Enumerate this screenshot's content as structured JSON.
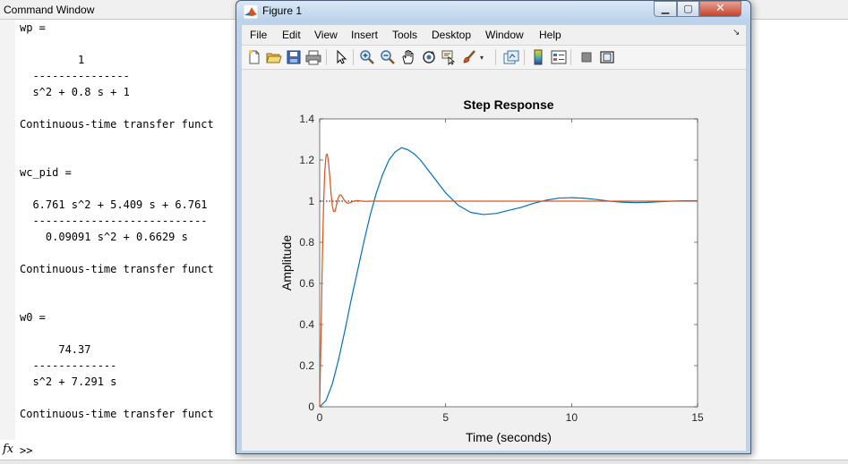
{
  "command_window": {
    "title": "Command Window",
    "lines": [
      "wp =",
      "",
      "         1",
      "  ---------------",
      "  s^2 + 0.8 s + 1",
      "",
      "Continuous-time transfer funct",
      "",
      "",
      "wc_pid =",
      "",
      "  6.761 s^2 + 5.409 s + 6.761",
      "  ---------------------------",
      "    0.09091 s^2 + 0.6629 s",
      "",
      "Continuous-time transfer funct",
      "",
      "",
      "w0 =",
      "",
      "      74.37",
      "  -------------",
      "  s^2 + 7.291 s",
      "",
      "Continuous-time transfer funct"
    ],
    "fx_icon": "fx",
    "prompt": ">>"
  },
  "figure_window": {
    "title": "Figure 1",
    "window_buttons": {
      "minimize": "minimize-icon",
      "maximize": "maximize-icon",
      "close": "close-icon"
    },
    "menu": [
      "File",
      "Edit",
      "View",
      "Insert",
      "Tools",
      "Desktop",
      "Window",
      "Help"
    ],
    "toolbar_icons": [
      "new-figure-icon",
      "open-file-icon",
      "save-icon",
      "print-icon",
      "select-arrow-icon",
      "zoom-in-icon",
      "zoom-out-icon",
      "pan-icon",
      "rotate-3d-icon",
      "data-cursor-icon",
      "brush-icon",
      "link-plot-icon",
      "colorbar-icon",
      "legend-icon",
      "hide-plot-tools-icon",
      "show-plot-tools-icon"
    ]
  },
  "chart_data": {
    "type": "line",
    "title": "Step Response",
    "xlabel": "Time (seconds)",
    "ylabel": "Amplitude",
    "xlim": [
      0,
      15
    ],
    "ylim": [
      0,
      1.4
    ],
    "xticks": [
      0,
      5,
      10,
      15
    ],
    "yticks": [
      0,
      0.2,
      0.4,
      0.6,
      0.8,
      1,
      1.2,
      1.4
    ],
    "grid": false,
    "colors": {
      "series_blue": "#0072bd",
      "series_orange": "#d95319"
    },
    "series": [
      {
        "color": "#0072bd",
        "x": [
          0,
          0.25,
          0.5,
          0.75,
          1,
          1.25,
          1.5,
          1.75,
          2,
          2.25,
          2.5,
          2.75,
          3,
          3.25,
          3.5,
          3.75,
          4,
          4.5,
          5,
          5.5,
          6,
          6.5,
          7,
          7.5,
          8,
          8.5,
          9,
          9.5,
          10,
          10.5,
          11,
          11.5,
          12,
          12.5,
          13,
          13.5,
          14,
          14.5,
          15
        ],
        "y": [
          0,
          0.03,
          0.11,
          0.23,
          0.37,
          0.52,
          0.66,
          0.8,
          0.93,
          1.04,
          1.13,
          1.2,
          1.24,
          1.26,
          1.25,
          1.23,
          1.2,
          1.12,
          1.04,
          0.98,
          0.945,
          0.935,
          0.94,
          0.955,
          0.97,
          0.99,
          1.005,
          1.015,
          1.017,
          1.014,
          1.008,
          1.0,
          0.995,
          0.993,
          0.994,
          0.997,
          1.0,
          1.002,
          1.002
        ]
      },
      {
        "color": "#d95319",
        "x": [
          0,
          0.05,
          0.1,
          0.15,
          0.2,
          0.25,
          0.3,
          0.35,
          0.4,
          0.45,
          0.5,
          0.55,
          0.6,
          0.65,
          0.7,
          0.75,
          0.8,
          0.85,
          0.9,
          0.95,
          1.0,
          1.1,
          1.2,
          1.3,
          1.4,
          1.5,
          1.6,
          1.8,
          2.0,
          15
        ],
        "y": [
          0,
          0.33,
          0.68,
          0.96,
          1.14,
          1.22,
          1.23,
          1.19,
          1.12,
          1.04,
          0.98,
          0.95,
          0.95,
          0.97,
          1.0,
          1.02,
          1.03,
          1.03,
          1.02,
          1.01,
          1.0,
          0.99,
          0.992,
          0.998,
          1.002,
          1.003,
          1.001,
          0.999,
          1.0,
          1.0
        ]
      }
    ],
    "reference_line": {
      "y": 1,
      "x_end": 1.8,
      "style": "dotted"
    }
  }
}
